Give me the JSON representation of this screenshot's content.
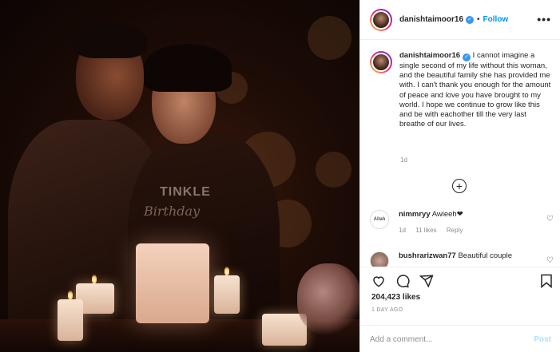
{
  "post": {
    "username": "danishtaimoor16",
    "follow_label": "Follow",
    "more_label": "•••",
    "caption": "I cannot imagine a single second of my life without this woman, and the beautiful family she has provided me with. I can't thank you enough for the amount of peace and love you have brought to my world. I hope we continue to grow like this and be with eachother till the very last breathe of our lives.",
    "caption_time": "1d",
    "load_more": "+",
    "likes": "204,423 likes",
    "time_ago": "1 DAY AGO",
    "comment_placeholder": "Add a comment...",
    "post_label": "Post"
  },
  "photo": {
    "shirt_text": "TINKLE",
    "topper_text": "Birthday"
  },
  "comments": [
    {
      "avatar_text": "Allah",
      "username": "nimmryy",
      "text": "Awieeh❤",
      "time": "1d",
      "likes": "11 likes",
      "reply": "Reply"
    },
    {
      "avatar_text": "",
      "username": "bushrarizwan77",
      "text": "Beautiful couple",
      "time": "",
      "likes": "",
      "reply": ""
    }
  ],
  "colors": {
    "accent": "#0095f6",
    "verified": "#3897f0",
    "muted": "#8e8e8e",
    "post_disabled": "#b2dffc"
  },
  "icons": {
    "verified": "verified-badge-icon",
    "like": "heart-icon",
    "comment": "comment-icon",
    "share": "share-icon",
    "save": "bookmark-icon",
    "more": "more-options-icon"
  }
}
